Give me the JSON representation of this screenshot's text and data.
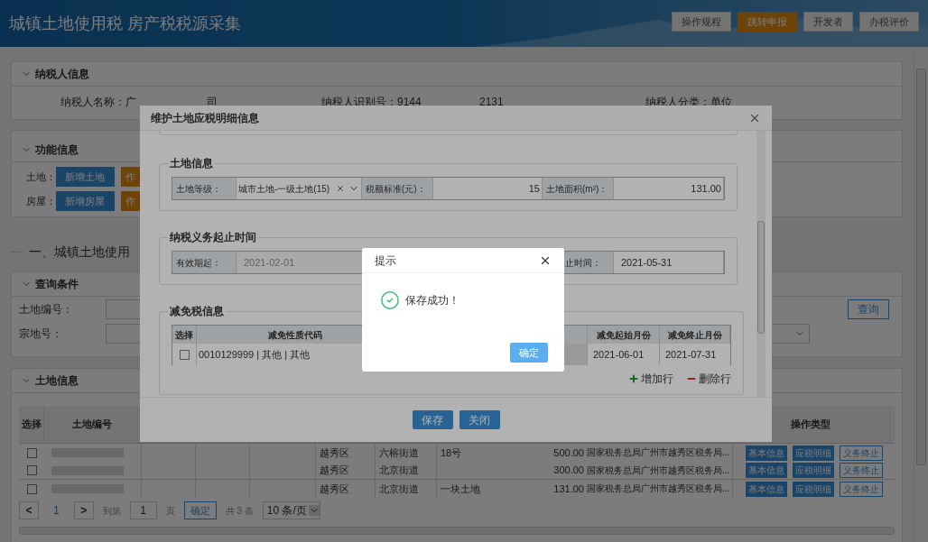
{
  "header": {
    "title": "城镇土地使用税 房产税税源采集",
    "buttons": [
      {
        "label": "操作规程",
        "kind": "plain"
      },
      {
        "label": "跳转申报",
        "kind": "primary"
      },
      {
        "label": "开发者",
        "kind": "plain"
      },
      {
        "label": "办税评价",
        "kind": "plain"
      }
    ]
  },
  "taxpayer_panel": {
    "title": "纳税人信息",
    "fields": [
      "纳税人名称：广",
      "司",
      "纳税人识别号：9144",
      "2131",
      "纳税人分类：单位"
    ]
  },
  "function_panel": {
    "title": "功能信息",
    "rows": [
      {
        "label": "土地：",
        "buttons": [
          "新增土地",
          "作"
        ]
      },
      {
        "label": "房屋：",
        "buttons": [
          "新增房屋",
          "作"
        ]
      }
    ]
  },
  "section_heading": "一、城镇土地使用",
  "query_panel": {
    "title": "查询条件",
    "fields": [
      {
        "label": "土地编号："
      },
      {
        "label": "宗地号："
      }
    ],
    "button": "查询"
  },
  "land_panel": {
    "title": "土地信息",
    "columns": [
      "选择",
      "土地编号",
      "操作类型"
    ],
    "rows": [
      {
        "checked": false,
        "district": "越秀区",
        "street": "六榕街道",
        "name": "18号",
        "area": "500.00",
        "office": "国家税务总局广州市越秀区税务局...",
        "actions": [
          "基本信息",
          "应税明细",
          "义务终止"
        ]
      },
      {
        "checked": false,
        "district": "越秀区",
        "street": "北京街道",
        "area": "300.00",
        "office": "国家税务总局广州市越秀区税务局...",
        "actions": [
          "基本信息",
          "应税明细",
          "义务终止"
        ]
      },
      {
        "checked": false,
        "district": "越秀区",
        "street": "北京街道",
        "name": "一块土地",
        "area": "131.00",
        "office": "国家税务总局广州市越秀区税务局...",
        "actions": [
          "基本信息",
          "应税明细",
          "义务终止"
        ]
      }
    ],
    "pager": {
      "prev": "<",
      "pages": [
        {
          "label": "1",
          "selected": true
        }
      ],
      "next": ">",
      "goto_label": "到第",
      "goto_value": "1",
      "page_unit": "页",
      "goto_button": "确定",
      "total": "共 3 条",
      "page_size": "10 条/页"
    }
  },
  "modal": {
    "title": "维护土地应税明细信息",
    "land_info": {
      "title": "土地信息",
      "fields": [
        {
          "label": "土地等级：",
          "value": "城市土地-一级土地(15)",
          "kind": "select"
        },
        {
          "label": "税额标准(元)：",
          "value": "15",
          "kind": "number"
        },
        {
          "label": "土地面积(m²)：",
          "value": "131.00",
          "kind": "number"
        }
      ]
    },
    "period": {
      "title": "纳税义务起止时间",
      "fields": [
        {
          "label": "有效期起：",
          "value": "2021-02-01",
          "disabled": true
        },
        {
          "label": "止时间：",
          "value": "2021-05-31",
          "disabled": false
        }
      ]
    },
    "relief": {
      "title": "减免税信息",
      "columns": [
        "选择",
        "减免性质代码",
        "减免起始月份",
        "减免终止月份"
      ],
      "rows": [
        {
          "checked": false,
          "code": "0010129999 | 其他 | 其他",
          "start": "2021-06-01",
          "end": "2021-07-31"
        }
      ],
      "actions": [
        "增加行",
        "删除行"
      ]
    },
    "buttons": [
      "保存",
      "关闭"
    ]
  },
  "alert": {
    "title": "提示",
    "message": "保存成功！",
    "button": "确定"
  }
}
